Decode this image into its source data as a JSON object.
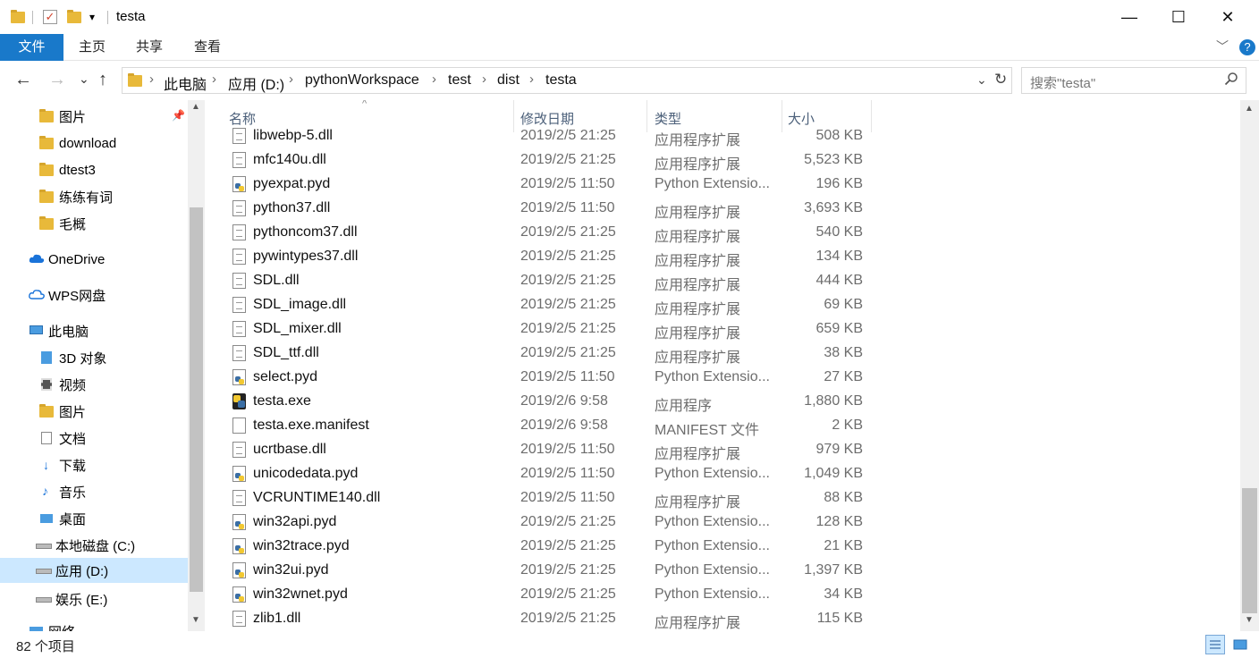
{
  "window": {
    "title": "testa"
  },
  "icons": {
    "folder": "folder-icon",
    "properties": "properties-check-icon",
    "pin": "pin-icon"
  },
  "controls": {
    "dropdown": "▾",
    "minimize": "—",
    "maximize": "☐",
    "close": "✕",
    "chevron": "﹀",
    "help": "?"
  },
  "ribbon": {
    "tabs": [
      "文件",
      "主页",
      "共享",
      "查看"
    ]
  },
  "nav": {
    "back": "←",
    "forward": "→",
    "recent": "⌄",
    "up": "↑",
    "refresh": "↻",
    "addr_dropdown": "⌄"
  },
  "address": {
    "crumbs": [
      "此电脑",
      "应用 (D:)",
      "pythonWorkspace",
      "test",
      "dist",
      "testa"
    ]
  },
  "search": {
    "placeholder": "搜索\"testa\""
  },
  "sidebar": {
    "items": [
      {
        "label": "图片",
        "icon": "pictures-folder-icon"
      },
      {
        "label": "download",
        "icon": "folder-icon"
      },
      {
        "label": "dtest3",
        "icon": "folder-icon"
      },
      {
        "label": "练练有词",
        "icon": "folder-icon"
      },
      {
        "label": "毛概",
        "icon": "folder-icon"
      },
      {
        "label": "OneDrive",
        "icon": "onedrive-icon"
      },
      {
        "label": "WPS网盘",
        "icon": "cloud-icon"
      },
      {
        "label": "此电脑",
        "icon": "computer-icon"
      },
      {
        "label": "3D 对象",
        "icon": "3d-objects-icon"
      },
      {
        "label": "视频",
        "icon": "videos-icon"
      },
      {
        "label": "图片",
        "icon": "pictures-icon"
      },
      {
        "label": "文档",
        "icon": "documents-icon"
      },
      {
        "label": "下载",
        "icon": "downloads-icon"
      },
      {
        "label": "音乐",
        "icon": "music-icon"
      },
      {
        "label": "桌面",
        "icon": "desktop-icon"
      },
      {
        "label": "本地磁盘 (C:)",
        "icon": "drive-c-icon"
      },
      {
        "label": "应用 (D:)",
        "icon": "drive-icon"
      },
      {
        "label": "娱乐 (E:)",
        "icon": "drive-icon"
      },
      {
        "label": "网络",
        "icon": "network-icon"
      }
    ]
  },
  "columns": {
    "name": "名称",
    "date": "修改日期",
    "type": "类型",
    "size": "大小"
  },
  "files": [
    {
      "name": "libwebp-5.dll",
      "date": "2019/2/5 21:25",
      "type": "应用程序扩展",
      "size": "508 KB",
      "icon": "dll"
    },
    {
      "name": "mfc140u.dll",
      "date": "2019/2/5 21:25",
      "type": "应用程序扩展",
      "size": "5,523 KB",
      "icon": "dll"
    },
    {
      "name": "pyexpat.pyd",
      "date": "2019/2/5 11:50",
      "type": "Python Extensio...",
      "size": "196 KB",
      "icon": "pyd"
    },
    {
      "name": "python37.dll",
      "date": "2019/2/5 11:50",
      "type": "应用程序扩展",
      "size": "3,693 KB",
      "icon": "dll"
    },
    {
      "name": "pythoncom37.dll",
      "date": "2019/2/5 21:25",
      "type": "应用程序扩展",
      "size": "540 KB",
      "icon": "dll"
    },
    {
      "name": "pywintypes37.dll",
      "date": "2019/2/5 21:25",
      "type": "应用程序扩展",
      "size": "134 KB",
      "icon": "dll"
    },
    {
      "name": "SDL.dll",
      "date": "2019/2/5 21:25",
      "type": "应用程序扩展",
      "size": "444 KB",
      "icon": "dll"
    },
    {
      "name": "SDL_image.dll",
      "date": "2019/2/5 21:25",
      "type": "应用程序扩展",
      "size": "69 KB",
      "icon": "dll"
    },
    {
      "name": "SDL_mixer.dll",
      "date": "2019/2/5 21:25",
      "type": "应用程序扩展",
      "size": "659 KB",
      "icon": "dll"
    },
    {
      "name": "SDL_ttf.dll",
      "date": "2019/2/5 21:25",
      "type": "应用程序扩展",
      "size": "38 KB",
      "icon": "dll"
    },
    {
      "name": "select.pyd",
      "date": "2019/2/5 11:50",
      "type": "Python Extensio...",
      "size": "27 KB",
      "icon": "pyd"
    },
    {
      "name": "testa.exe",
      "date": "2019/2/6 9:58",
      "type": "应用程序",
      "size": "1,880 KB",
      "icon": "exe"
    },
    {
      "name": "testa.exe.manifest",
      "date": "2019/2/6 9:58",
      "type": "MANIFEST 文件",
      "size": "2 KB",
      "icon": "blank"
    },
    {
      "name": "ucrtbase.dll",
      "date": "2019/2/5 11:50",
      "type": "应用程序扩展",
      "size": "979 KB",
      "icon": "dll"
    },
    {
      "name": "unicodedata.pyd",
      "date": "2019/2/5 11:50",
      "type": "Python Extensio...",
      "size": "1,049 KB",
      "icon": "pyd"
    },
    {
      "name": "VCRUNTIME140.dll",
      "date": "2019/2/5 11:50",
      "type": "应用程序扩展",
      "size": "88 KB",
      "icon": "dll"
    },
    {
      "name": "win32api.pyd",
      "date": "2019/2/5 21:25",
      "type": "Python Extensio...",
      "size": "128 KB",
      "icon": "pyd"
    },
    {
      "name": "win32trace.pyd",
      "date": "2019/2/5 21:25",
      "type": "Python Extensio...",
      "size": "21 KB",
      "icon": "pyd"
    },
    {
      "name": "win32ui.pyd",
      "date": "2019/2/5 21:25",
      "type": "Python Extensio...",
      "size": "1,397 KB",
      "icon": "pyd"
    },
    {
      "name": "win32wnet.pyd",
      "date": "2019/2/5 21:25",
      "type": "Python Extensio...",
      "size": "34 KB",
      "icon": "pyd"
    },
    {
      "name": "zlib1.dll",
      "date": "2019/2/5 21:25",
      "type": "应用程序扩展",
      "size": "115 KB",
      "icon": "dll"
    }
  ],
  "status": {
    "count": "82 个项目"
  },
  "colors": {
    "accent": "#1979ca",
    "selected": "#cce8ff",
    "header_text": "#4c607a"
  }
}
